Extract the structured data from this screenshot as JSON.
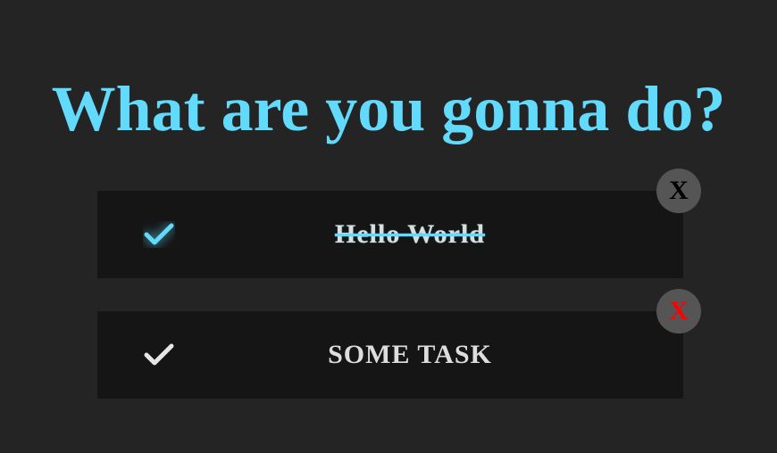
{
  "header": {
    "title": "What are you gonna do?"
  },
  "tasks": [
    {
      "text": "Hello World",
      "completed": true,
      "check_icon": "checkmark-icon",
      "delete_label": "X",
      "delete_color": "#000000"
    },
    {
      "text": "SOME TASK",
      "completed": false,
      "check_icon": "checkmark-icon",
      "delete_label": "X",
      "delete_color": "#ff0000"
    }
  ],
  "colors": {
    "background": "#242424",
    "card": "#151515",
    "accent": "#61dafb",
    "delete_button_bg": "#555555"
  }
}
